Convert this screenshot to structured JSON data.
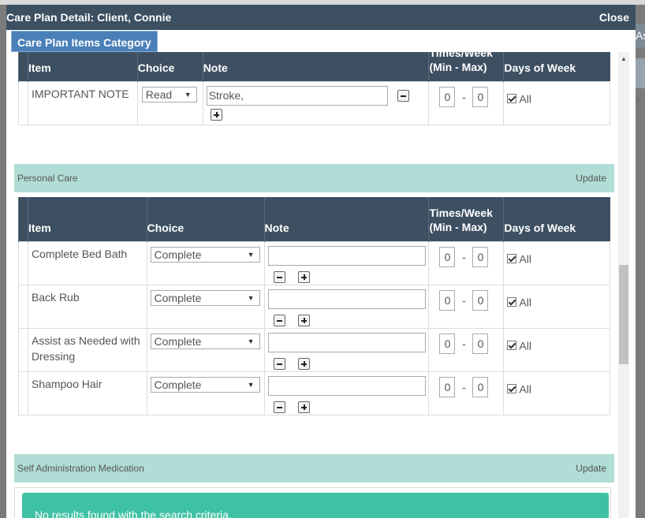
{
  "background": {
    "right_header_text": "As",
    "right_text": "y"
  },
  "modal": {
    "title": "Care Plan Detail: Client, Connie",
    "close_label": "Close",
    "active_tab": "Care Plan Items Category"
  },
  "columns": {
    "item": "Item",
    "choice": "Choice",
    "note": "Note",
    "times_line1": "Times/Week",
    "times_line2": "(Min - Max)",
    "days": "Days of Week"
  },
  "important_table": {
    "rows": [
      {
        "item": "IMPORTANT NOTE",
        "choice": "Read",
        "note": "Stroke,",
        "min": "0",
        "max": "0",
        "days": "All",
        "all_checked": true
      }
    ]
  },
  "personal_care": {
    "title": "Personal Care",
    "update_label": "Update",
    "rows": [
      {
        "item": "Complete Bed Bath",
        "choice": "Complete",
        "note": "",
        "min": "0",
        "max": "0",
        "days": "All",
        "all_checked": true
      },
      {
        "item": "Back Rub",
        "choice": "Complete",
        "note": "",
        "min": "0",
        "max": "0",
        "days": "All",
        "all_checked": true
      },
      {
        "item": "Assist as Needed with Dressing",
        "choice": "Complete",
        "note": "",
        "min": "0",
        "max": "0",
        "days": "All",
        "all_checked": true
      },
      {
        "item": "Shampoo Hair",
        "choice": "Complete",
        "note": "",
        "min": "0",
        "max": "0",
        "days": "All",
        "all_checked": true
      }
    ]
  },
  "self_admin": {
    "title": "Self Administration Medication",
    "update_label": "Update",
    "no_results": "No results found with the search criteria."
  },
  "dash": "-",
  "colors": {
    "header_bg": "#3d5062",
    "tab_bg": "#4a80b8",
    "section_bg": "#b0ddd6",
    "alert_bg": "#3fc1a4"
  }
}
